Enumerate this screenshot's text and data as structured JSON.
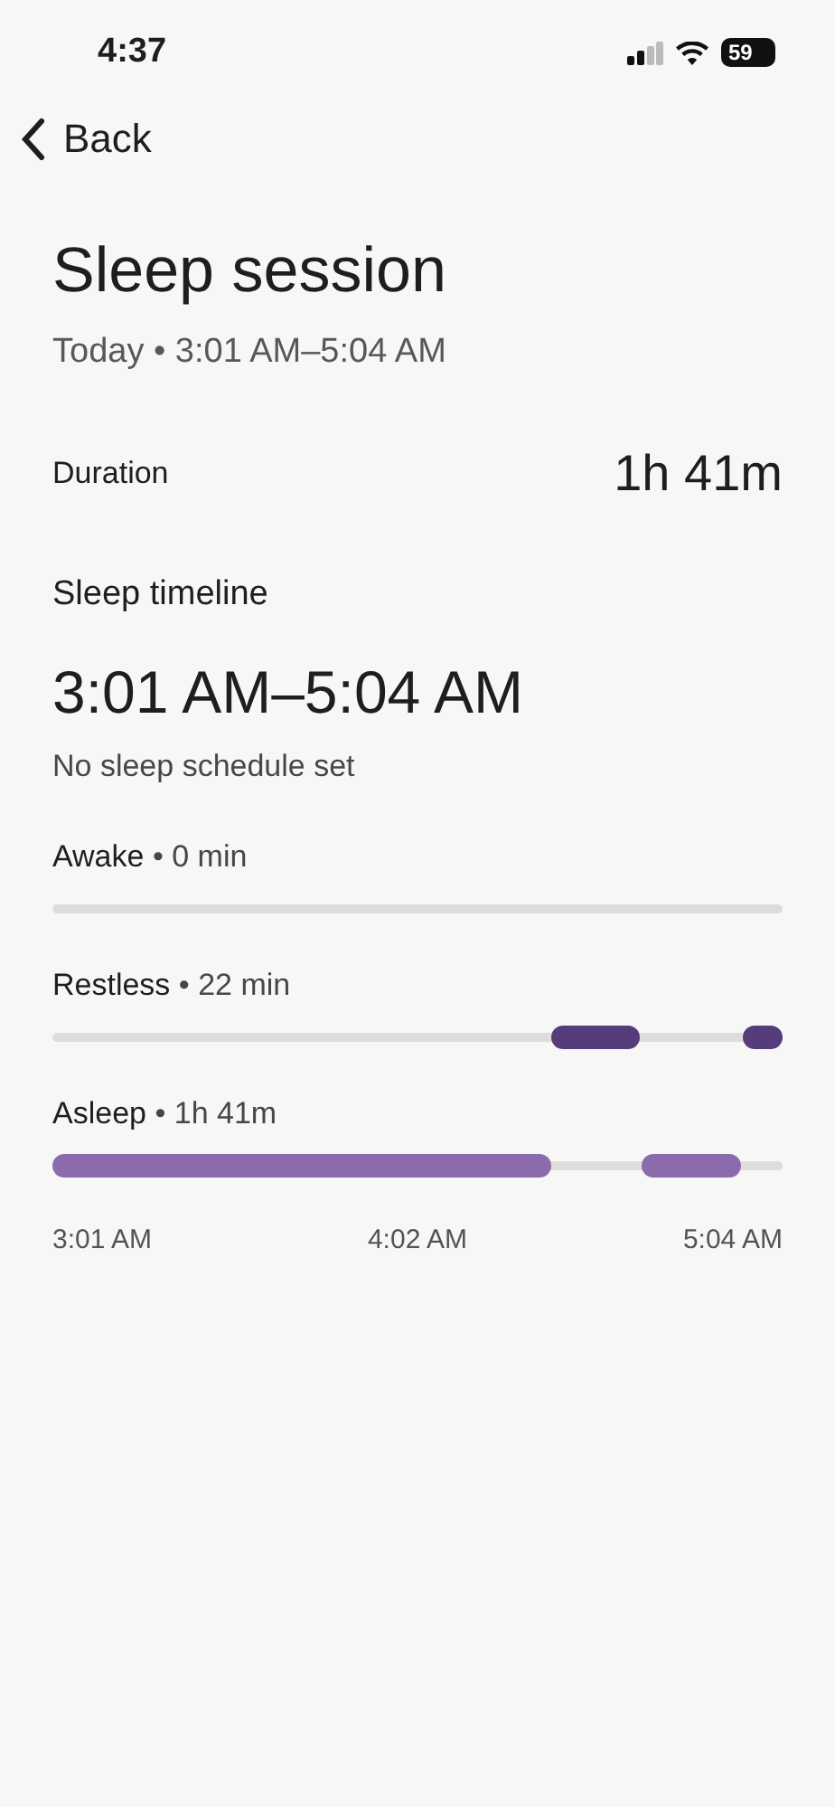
{
  "status_bar": {
    "time": "4:37",
    "battery": "59"
  },
  "nav": {
    "back": "Back"
  },
  "title": "Sleep session",
  "subtitle": "Today • 3:01 AM–5:04 AM",
  "duration": {
    "label": "Duration",
    "value": "1h 41m"
  },
  "timeline": {
    "heading": "Sleep timeline",
    "range": "3:01 AM–5:04 AM",
    "note": "No sleep schedule set",
    "stages": [
      {
        "name": "Awake",
        "amount": "• 0 min"
      },
      {
        "name": "Restless",
        "amount": "• 22 min"
      },
      {
        "name": "Asleep",
        "amount": "• 1h 41m"
      }
    ],
    "axis": [
      "3:01 AM",
      "4:02 AM",
      "5:04 AM"
    ]
  }
}
